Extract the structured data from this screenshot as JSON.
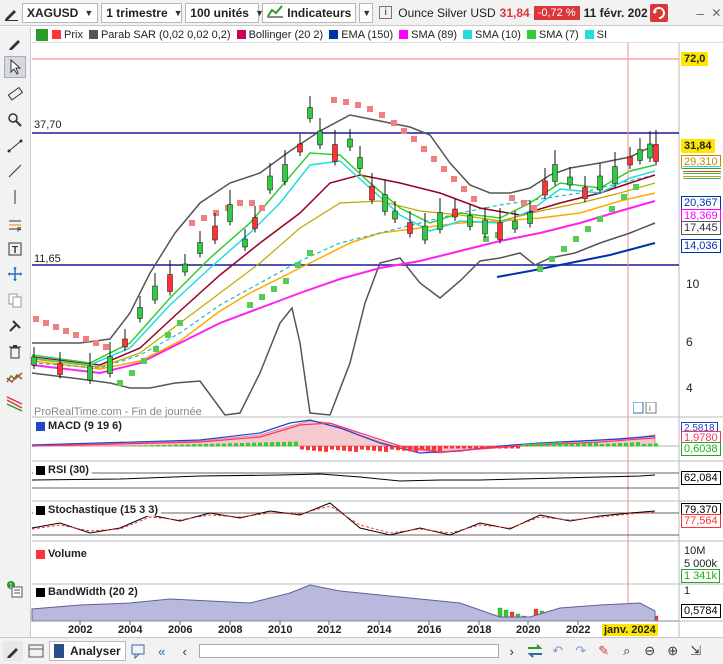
{
  "toolbar": {
    "symbol": "XAGUSD",
    "period": "1 trimestre",
    "units": "100 unités",
    "indicators": "Indicateurs",
    "instrument_name": "Ounce Silver USD",
    "last_price": "31,84",
    "change": "-0,72 %",
    "date": "11 févr. 202"
  },
  "legend": {
    "items": [
      {
        "label": "Prix",
        "color": "#ff3333"
      },
      {
        "label": "Parab SAR (0,02 0,02 0,2)",
        "color": "#555555"
      },
      {
        "label": "Bollinger (20 2)",
        "color": "#cc0055"
      },
      {
        "label": "EMA (150)",
        "color": "#0033aa"
      },
      {
        "label": "SMA (89)",
        "color": "#ff00ff"
      },
      {
        "label": "SMA (10)",
        "color": "#22dddd"
      },
      {
        "label": "SMA (7)",
        "color": "#33cc33"
      },
      {
        "label": "SI",
        "color": "#22dddd"
      }
    ]
  },
  "main_chart": {
    "level_labels": [
      "37,70",
      "11,65"
    ],
    "watermark": "ProRealTime.com - Fin de journée",
    "axis_ticks": [
      "10",
      "6",
      "4"
    ],
    "price_boxes": [
      {
        "text": "72,0",
        "bg": "#ffe600",
        "fg": "#000000"
      },
      {
        "text": "31,84",
        "bg": "#ffe600",
        "fg": "#000000"
      },
      {
        "text": "29,310",
        "bg": "#ffffff",
        "fg": "#cc8800"
      },
      {
        "text": "20,367",
        "bg": "#ffffff",
        "fg": "#0033aa"
      },
      {
        "text": "18,369",
        "bg": "#ffffff",
        "fg": "#ff00ff"
      },
      {
        "text": "17,445",
        "bg": "#ffffff",
        "fg": "#333333"
      },
      {
        "text": "14,036",
        "bg": "#ffffff",
        "fg": "#0033aa"
      }
    ]
  },
  "panes": {
    "macd": {
      "title": "MACD (9 19 6)",
      "values": [
        "2,5818",
        "1,9780",
        "0,6038"
      ],
      "colors": [
        "#2244cc",
        "#ff3366",
        "#22aa22"
      ]
    },
    "rsi": {
      "title": "RSI (30)",
      "values": [
        "62,084"
      ]
    },
    "stoch": {
      "title": "Stochastique (15 3 3)",
      "values": [
        "79,370",
        "77,564"
      ]
    },
    "volume": {
      "title": "Volume",
      "values": [
        "10M",
        "5 000k",
        "1 341k"
      ]
    },
    "bandwidth": {
      "title": "BandWidth (20 2)",
      "values": [
        "1",
        "0,5784"
      ]
    }
  },
  "x_axis": {
    "labels": [
      "2002",
      "2004",
      "2006",
      "2008",
      "2010",
      "2012",
      "2014",
      "2016",
      "2018",
      "2020",
      "2022"
    ],
    "current": "janv. 2024"
  },
  "bottombar": {
    "analyser": "Analyser"
  }
}
